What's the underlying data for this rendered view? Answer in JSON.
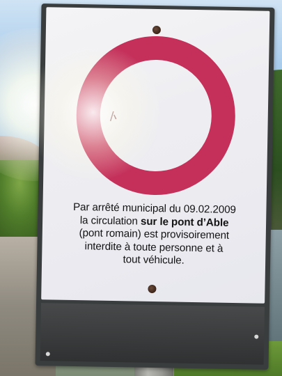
{
  "photo": {
    "subject": "road-sign"
  },
  "sign": {
    "symbol": "no-vehicles-ring",
    "ring_color": "#c4305a",
    "lines": [
      "Par arrêté municipal du 09.02.2009",
      "la circulation ",
      "sur le pont d’Able",
      "(pont romain) est provisoirement",
      "interdite à toute personne et à",
      "tout véhicule."
    ]
  }
}
